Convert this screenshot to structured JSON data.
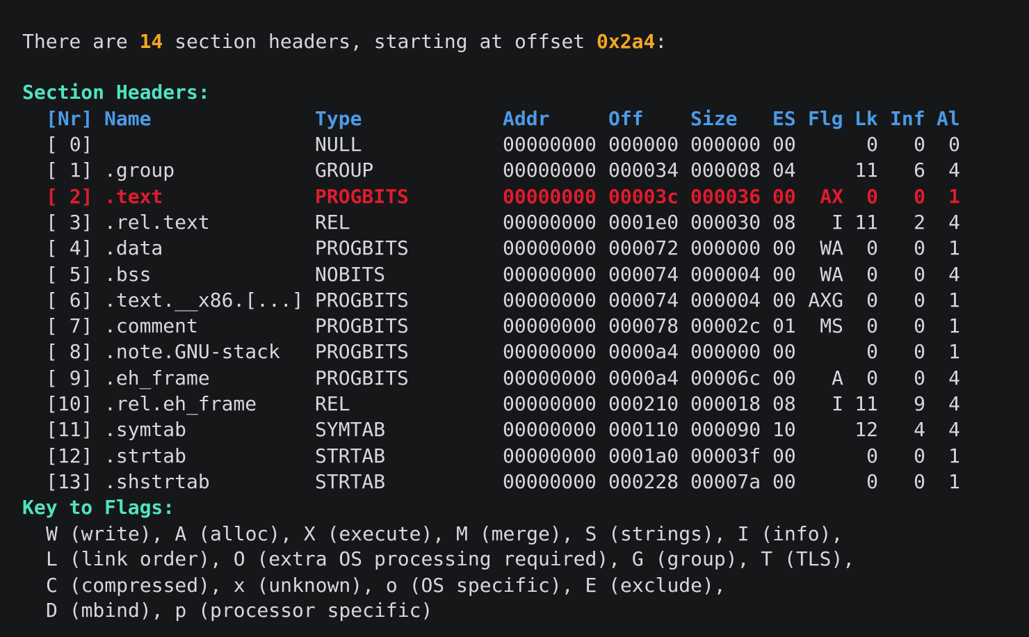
{
  "intro": {
    "prefix": "There are ",
    "count": "14",
    "middle": " section headers, starting at offset ",
    "offset": "0x2a4",
    "suffix": ":"
  },
  "section_title": "Section Headers:",
  "columns": {
    "nr": "[Nr]",
    "name": "Name",
    "type": "Type",
    "addr": "Addr",
    "off": "Off",
    "size": "Size",
    "es": "ES",
    "flg": "Flg",
    "lk": "Lk",
    "inf": "Inf",
    "al": "Al"
  },
  "rows": [
    {
      "nr": "[ 0]",
      "name": "",
      "type": "NULL",
      "addr": "00000000",
      "off": "000000",
      "size": "000000",
      "es": "00",
      "flg": "",
      "lk": "0",
      "inf": "0",
      "al": "0"
    },
    {
      "nr": "[ 1]",
      "name": ".group",
      "type": "GROUP",
      "addr": "00000000",
      "off": "000034",
      "size": "000008",
      "es": "04",
      "flg": "",
      "lk": "11",
      "inf": "6",
      "al": "4"
    },
    {
      "nr": "[ 2]",
      "name": ".text",
      "type": "PROGBITS",
      "addr": "00000000",
      "off": "00003c",
      "size": "000036",
      "es": "00",
      "flg": "AX",
      "lk": "0",
      "inf": "0",
      "al": "1",
      "highlight": true
    },
    {
      "nr": "[ 3]",
      "name": ".rel.text",
      "type": "REL",
      "addr": "00000000",
      "off": "0001e0",
      "size": "000030",
      "es": "08",
      "flg": "I",
      "lk": "11",
      "inf": "2",
      "al": "4"
    },
    {
      "nr": "[ 4]",
      "name": ".data",
      "type": "PROGBITS",
      "addr": "00000000",
      "off": "000072",
      "size": "000000",
      "es": "00",
      "flg": "WA",
      "lk": "0",
      "inf": "0",
      "al": "1"
    },
    {
      "nr": "[ 5]",
      "name": ".bss",
      "type": "NOBITS",
      "addr": "00000000",
      "off": "000074",
      "size": "000004",
      "es": "00",
      "flg": "WA",
      "lk": "0",
      "inf": "0",
      "al": "4"
    },
    {
      "nr": "[ 6]",
      "name": ".text.__x86.[...]",
      "type": "PROGBITS",
      "addr": "00000000",
      "off": "000074",
      "size": "000004",
      "es": "00",
      "flg": "AXG",
      "lk": "0",
      "inf": "0",
      "al": "1"
    },
    {
      "nr": "[ 7]",
      "name": ".comment",
      "type": "PROGBITS",
      "addr": "00000000",
      "off": "000078",
      "size": "00002c",
      "es": "01",
      "flg": "MS",
      "lk": "0",
      "inf": "0",
      "al": "1"
    },
    {
      "nr": "[ 8]",
      "name": ".note.GNU-stack",
      "type": "PROGBITS",
      "addr": "00000000",
      "off": "0000a4",
      "size": "000000",
      "es": "00",
      "flg": "",
      "lk": "0",
      "inf": "0",
      "al": "1"
    },
    {
      "nr": "[ 9]",
      "name": ".eh_frame",
      "type": "PROGBITS",
      "addr": "00000000",
      "off": "0000a4",
      "size": "00006c",
      "es": "00",
      "flg": "A",
      "lk": "0",
      "inf": "0",
      "al": "4"
    },
    {
      "nr": "[10]",
      "name": ".rel.eh_frame",
      "type": "REL",
      "addr": "00000000",
      "off": "000210",
      "size": "000018",
      "es": "08",
      "flg": "I",
      "lk": "11",
      "inf": "9",
      "al": "4"
    },
    {
      "nr": "[11]",
      "name": ".symtab",
      "type": "SYMTAB",
      "addr": "00000000",
      "off": "000110",
      "size": "000090",
      "es": "10",
      "flg": "",
      "lk": "12",
      "inf": "4",
      "al": "4"
    },
    {
      "nr": "[12]",
      "name": ".strtab",
      "type": "STRTAB",
      "addr": "00000000",
      "off": "0001a0",
      "size": "00003f",
      "es": "00",
      "flg": "",
      "lk": "0",
      "inf": "0",
      "al": "1"
    },
    {
      "nr": "[13]",
      "name": ".shstrtab",
      "type": "STRTAB",
      "addr": "00000000",
      "off": "000228",
      "size": "00007a",
      "es": "00",
      "flg": "",
      "lk": "0",
      "inf": "0",
      "al": "1"
    }
  ],
  "key_title": "Key to Flags:",
  "key_lines": [
    "W (write), A (alloc), X (execute), M (merge), S (strings), I (info),",
    "L (link order), O (extra OS processing required), G (group), T (TLS),",
    "C (compressed), x (unknown), o (OS specific), E (exclude),",
    "D (mbind), p (processor specific)"
  ],
  "colors": {
    "background": "#161719",
    "text": "#d6d8dc",
    "number_accent": "#f5a623",
    "heading": "#4fe3c1",
    "column_header": "#4a9be8",
    "highlight_row": "#e01b2e"
  }
}
